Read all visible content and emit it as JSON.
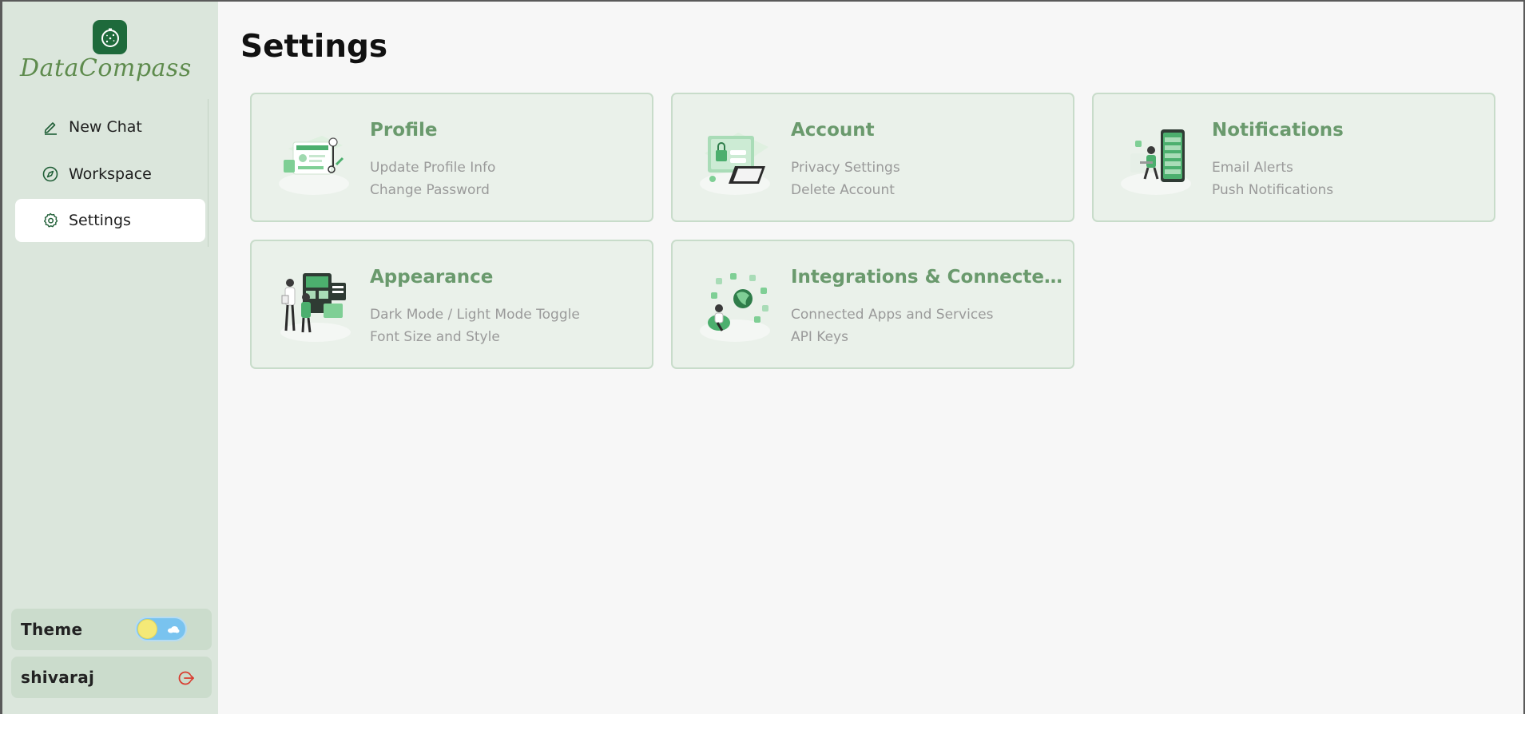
{
  "app": {
    "brand": "DataCompass",
    "logo_icon": "compass-icon"
  },
  "sidebar": {
    "items": [
      {
        "label": "New Chat",
        "icon": "pencil-icon",
        "active": false
      },
      {
        "label": "Workspace",
        "icon": "compass-icon",
        "active": false
      },
      {
        "label": "Settings",
        "icon": "gear-icon",
        "active": true
      }
    ],
    "theme": {
      "label": "Theme",
      "mode": "light"
    },
    "user": {
      "name": "shivaraj",
      "logout_icon": "logout-icon"
    }
  },
  "main": {
    "title": "Settings",
    "cards": [
      {
        "title": "Profile",
        "lines": [
          "Update Profile Info",
          "Change Password"
        ],
        "illustration": "profile-illustration"
      },
      {
        "title": "Account",
        "lines": [
          "Privacy Settings",
          "Delete Account"
        ],
        "illustration": "account-illustration"
      },
      {
        "title": "Notifications",
        "lines": [
          "Email Alerts",
          "Push Notifications"
        ],
        "illustration": "notifications-illustration"
      },
      {
        "title": "Appearance",
        "lines": [
          "Dark Mode / Light Mode Toggle",
          "Font Size and Style"
        ],
        "illustration": "appearance-illustration"
      },
      {
        "title": "Integrations & Connected ...",
        "lines": [
          "Connected Apps and Services",
          "API Keys"
        ],
        "illustration": "integrations-illustration"
      }
    ]
  },
  "colors": {
    "accent": "#1e6a3b",
    "sidebar_bg": "#dbe6dc",
    "card_bg": "#eaf1ea",
    "card_title": "#6a9a6d",
    "brand_text": "#5e8b4d",
    "logout": "#d93c2f"
  }
}
